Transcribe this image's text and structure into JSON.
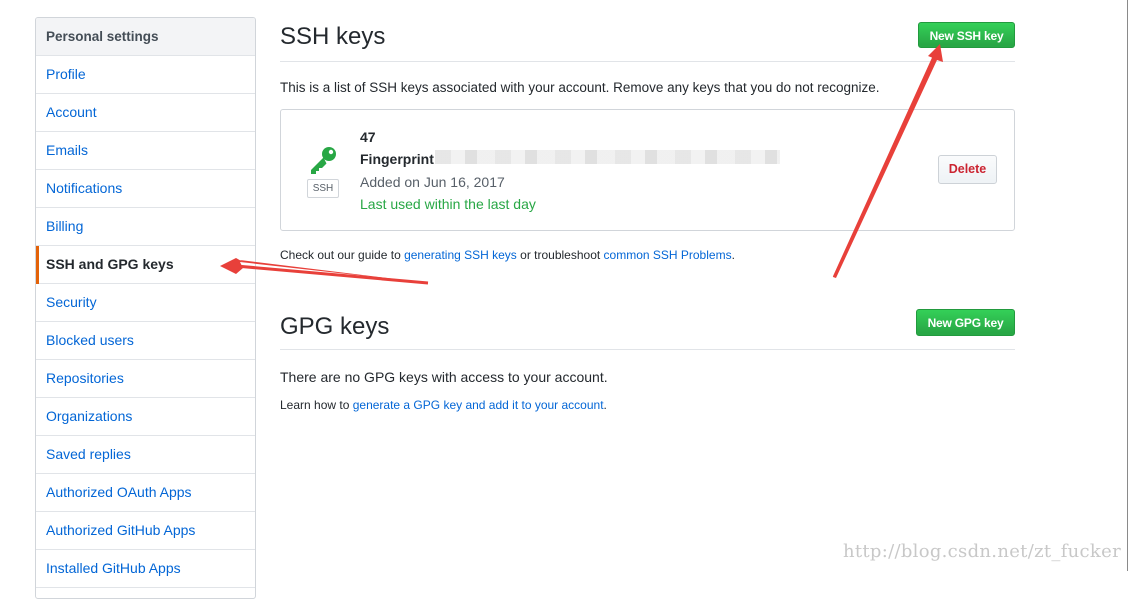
{
  "sidebar": {
    "header": "Personal settings",
    "items": [
      {
        "label": "Profile"
      },
      {
        "label": "Account"
      },
      {
        "label": "Emails"
      },
      {
        "label": "Notifications"
      },
      {
        "label": "Billing"
      },
      {
        "label": "SSH and GPG keys",
        "selected": true
      },
      {
        "label": "Security"
      },
      {
        "label": "Blocked users"
      },
      {
        "label": "Repositories"
      },
      {
        "label": "Organizations"
      },
      {
        "label": "Saved replies"
      },
      {
        "label": "Authorized OAuth Apps"
      },
      {
        "label": "Authorized GitHub Apps"
      },
      {
        "label": "Installed GitHub Apps"
      }
    ]
  },
  "ssh": {
    "title": "SSH keys",
    "new_button": "New SSH key",
    "description": "This is a list of SSH keys associated with your account. Remove any keys that you do not recognize.",
    "key": {
      "title": "47",
      "fingerprint_label": "Fingerprint",
      "added": "Added on Jun 16, 2017",
      "last_used": "Last used within the last day",
      "badge": "SSH",
      "delete_button": "Delete"
    },
    "guide": {
      "prefix": "Check out our guide to ",
      "link1": "generating SSH keys",
      "middle": " or troubleshoot ",
      "link2": "common SSH Problems",
      "suffix": "."
    }
  },
  "gpg": {
    "title": "GPG keys",
    "new_button": "New GPG key",
    "empty": "There are no GPG keys with access to your account.",
    "learn": {
      "prefix": "Learn how to ",
      "link": "generate a GPG key and add it to your account",
      "suffix": "."
    }
  },
  "watermark": "http://blog.csdn.net/zt_fucker",
  "colors": {
    "link": "#0366d6",
    "green_button": "#28a745",
    "selected_marker": "#e36209",
    "delete_text": "#cb2431",
    "annotation_arrow": "#e8403a"
  }
}
